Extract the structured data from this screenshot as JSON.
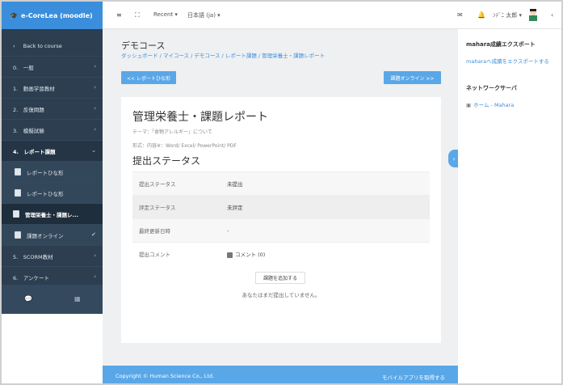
{
  "brand": {
    "title": "e-CoreLea (moodle)"
  },
  "topbar": {
    "recent_label": "Recent ▾",
    "lang_label": "日本語 (ja) ▾",
    "user_name": "ﾝﾃﾞﾆ 太郎 ▾"
  },
  "sidebar": {
    "back_label": "Back to course",
    "items": [
      {
        "label": "0.　一般"
      },
      {
        "label": "1.　動画学習教材"
      },
      {
        "label": "2.　反復問題"
      },
      {
        "label": "3.　模擬試験"
      },
      {
        "label": "4.　レポート課題"
      },
      {
        "label": "レポートひな形"
      },
      {
        "label": "レポートひな形"
      },
      {
        "label": "管理栄養士・課題レ..."
      },
      {
        "label": "課題オンライン"
      },
      {
        "label": "5.　SCORM教材"
      },
      {
        "label": "6.　アンケート"
      }
    ]
  },
  "header": {
    "course_title": "デモコース",
    "breadcrumb": "ダッシュボード / マイコース / デモコース / レポート課題 / 管理栄養士・課題レポート"
  },
  "nav_buttons": {
    "prev_label": "<< レポートひな形",
    "next_label": "課題オンライン >>"
  },
  "assignment": {
    "title": "管理栄養士・課題レポート",
    "theme_line": "テーマ：「食物アレルギー」について",
    "format_line": "形式：内容※：Word/ Excel/ PowerPoint/ PDF",
    "section_title": "提出ステータス",
    "rows": [
      {
        "label": "提出ステータス",
        "value": "未提出"
      },
      {
        "label": "評定ステータス",
        "value": "未評定"
      },
      {
        "label": "最終更新日時",
        "value": "-"
      },
      {
        "label": "提出コメント",
        "value": "コメント (0)"
      }
    ],
    "submit_label": "課題を追加する",
    "not_submitted_text": "あなたはまだ提出していません。"
  },
  "drawer": {
    "export_title": "mahara成績エクスポート",
    "export_link": "maharaへ成績をエクスポートする",
    "network_title": "ネットワークサーバ",
    "network_link": "ホーム - Mahara"
  },
  "footer": {
    "copyright": "Copyright © Human Science Co., Ltd.",
    "mobile_app": "モバイルアプリを取得する"
  }
}
